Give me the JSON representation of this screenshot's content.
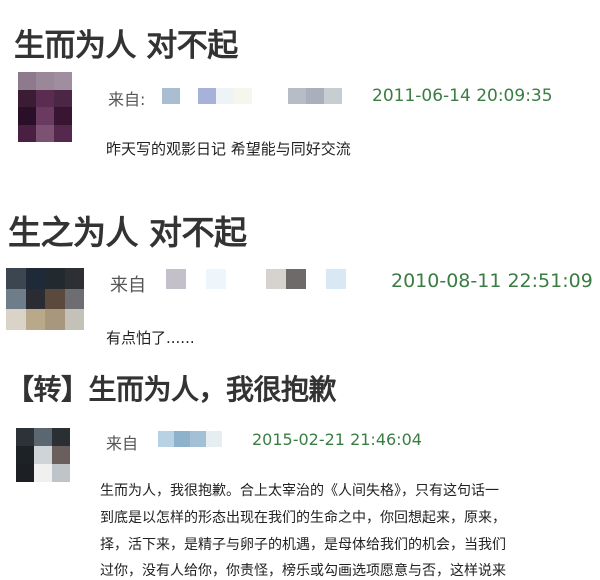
{
  "post1": {
    "title": "生而为人 对不起",
    "from_label": "来自:",
    "timestamp": "2011-06-14 20:09:35",
    "content": "昨天写的观影日记 希望能与同好交流"
  },
  "post2": {
    "title": "生之为人 对不起",
    "from_label": "来自",
    "timestamp": "2010-08-11 22:51:09",
    "content": "有点怕了......"
  },
  "post3": {
    "title": "【转】生而为人，我很抱歉",
    "from_label": "来自",
    "timestamp": "2015-02-21 21:46:04",
    "content_lines": [
      "生而为人，我很抱歉。合上太宰治的《人间失格》，只有这句话一",
      "到底是以怎样的形态出现在我们的生命之中，你回想起来，原来，",
      "择，活下来，是精子与卵子的机遇，是母体给我们的机会，当我们",
      "过你，没有人给你，你责怪，榜乐或勾画选项愿意与否，这样说来"
    ]
  },
  "colors": {
    "timestamp": "#3a7d43",
    "title": "#333333"
  }
}
